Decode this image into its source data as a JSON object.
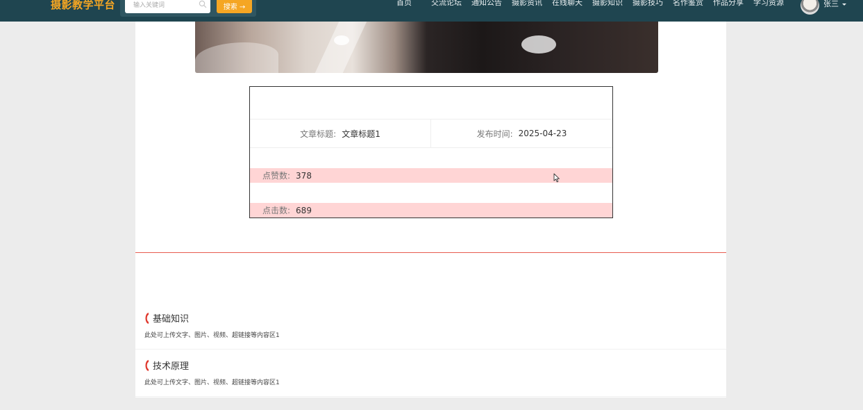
{
  "header": {
    "logo": "摄影教学平台",
    "search": {
      "placeholder": "输入关键词",
      "button_label": "搜索 →"
    },
    "nav": [
      "首页",
      "交流论坛",
      "通知公告",
      "摄影资讯",
      "在线聊天",
      "摄影知识",
      "摄影技巧",
      "名作鉴赏",
      "作品分享",
      "学习资源"
    ],
    "user_name": "张三"
  },
  "article": {
    "title_label": "文章标题:",
    "title_value": "文章标题1",
    "date_label": "发布时间:",
    "date_value": "2025-04-23",
    "likes_label": "点赞数:",
    "likes_value": "378",
    "clicks_label": "点击数:",
    "clicks_value": "689"
  },
  "sections": [
    {
      "title": "基础知识",
      "desc": "此处可上传文字、图片、视频、超链接等内容区1"
    },
    {
      "title": "技术原理",
      "desc": "此处可上传文字、图片、视频、超链接等内容区1"
    }
  ],
  "colors": {
    "header_bg": "#1f4550",
    "accent": "#f5a623",
    "highlight_row": "#ffd5d5",
    "divider": "#e85a4f",
    "section_marker": "#e03a2f"
  }
}
